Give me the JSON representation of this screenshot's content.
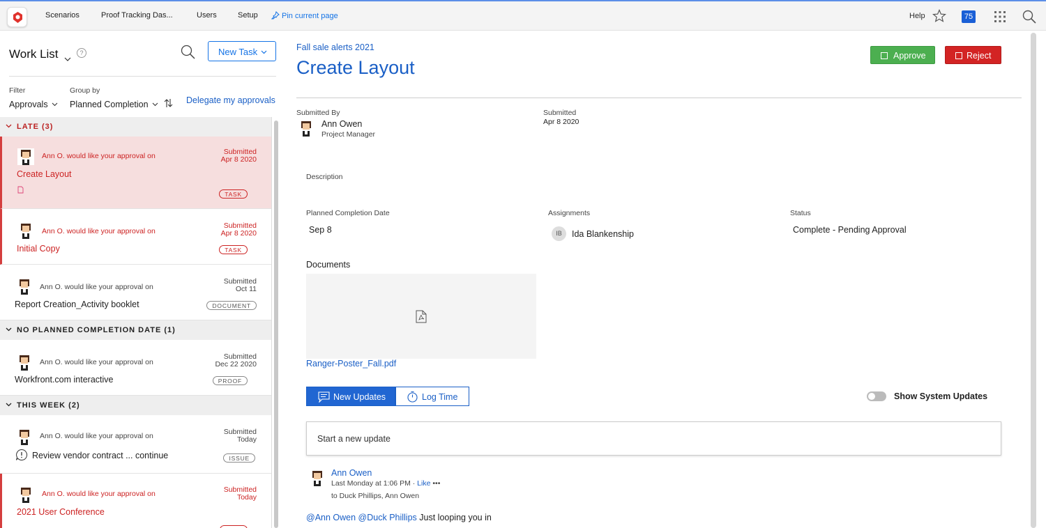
{
  "nav": {
    "items": [
      "Scenarios",
      "Proof Tracking Das...",
      "Users",
      "Setup"
    ],
    "pin": "Pin current page",
    "help": "Help",
    "notifications_count": "75"
  },
  "worklist": {
    "title": "Work List",
    "help_icon": "?",
    "new_task": "New Task",
    "filter_label": "Filter",
    "filter_value": "Approvals",
    "group_label": "Group by",
    "group_value": "Planned Completion",
    "delegate": "Delegate my approvals",
    "sections": [
      {
        "label": "LATE (3)",
        "items": [
          {
            "requester": "Ann O. would like your approval on",
            "title": "Create Layout",
            "submitted": "Submitted",
            "date": "Apr 8 2020",
            "tag": "TASK"
          },
          {
            "requester": "Ann O. would like your approval on",
            "title": "Initial Copy",
            "submitted": "Submitted",
            "date": "Apr 8 2020",
            "tag": "TASK"
          },
          {
            "requester": "Ann O. would like your approval on",
            "title": "Report Creation_Activity booklet",
            "submitted": "Submitted",
            "date": "Oct 11",
            "tag": "DOCUMENT"
          }
        ]
      },
      {
        "label": "NO PLANNED COMPLETION DATE (1)",
        "items": [
          {
            "requester": "Ann O. would like your approval on",
            "title": "Workfront.com interactive",
            "submitted": "Submitted",
            "date": "Dec 22 2020",
            "tag": "PROOF"
          }
        ]
      },
      {
        "label": "THIS WEEK (2)",
        "items": [
          {
            "requester": "Ann O. would like your approval on",
            "title": "Review vendor contract ...  continue",
            "submitted": "Submitted",
            "date": "Today",
            "tag": "ISSUE"
          },
          {
            "requester": "Ann O. would like your approval on",
            "title": "2021 User Conference",
            "submitted": "Submitted",
            "date": "Today",
            "tag": ""
          }
        ]
      }
    ]
  },
  "detail": {
    "breadcrumb": "Fall sale alerts 2021",
    "title": "Create Layout",
    "approve": "Approve",
    "reject": "Reject",
    "submitted_by_label": "Submitted By",
    "submitter_name": "Ann Owen",
    "submitter_role": "Project Manager",
    "submitted_label": "Submitted",
    "submitted_date": "Apr 8 2020",
    "description_label": "Description",
    "planned_label": "Planned Completion Date",
    "planned_value": "Sep 8",
    "assignments_label": "Assignments",
    "assignee_initials": "IB",
    "assignee_name": "Ida Blankenship",
    "status_label": "Status",
    "status_value": "Complete - Pending Approval",
    "documents_label": "Documents",
    "document_name": "Ranger-Poster_Fall.pdf",
    "tab_new_updates": "New Updates",
    "tab_log_time": "Log Time",
    "show_system_updates": "Show System Updates",
    "update_placeholder": "Start a new update",
    "update": {
      "author": "Ann Owen",
      "time": "Last Monday at 1:06 PM · ",
      "like": "Like",
      "more": " •••",
      "to": "to Duck Phillips, Ann Owen",
      "mention1": "@Ann Owen",
      "mention2": "@Duck Phillips",
      "body": " Just looping you in"
    }
  },
  "colors": {
    "brand_blue": "#1a5fc6",
    "late_red": "#c22222",
    "approve_green": "#4caf50",
    "reject_red": "#d32424"
  }
}
